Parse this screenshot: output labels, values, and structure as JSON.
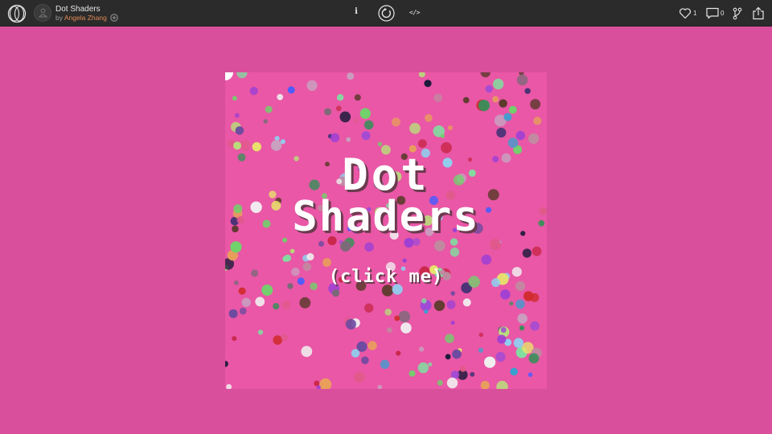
{
  "header": {
    "title": "Dot Shaders",
    "byline_prefix": "by",
    "author": "Angela Zhang",
    "info_label": "i",
    "code_label": "</>",
    "likes": "1",
    "comments": "0"
  },
  "stage": {
    "headline_line1": "Dot",
    "headline_line2": "Shaders",
    "cta": "(click me)"
  },
  "colors": {
    "page_bg": "#d94f9b",
    "stage_bg": "#e957a6",
    "topbar_bg": "#2b2b2b",
    "author_accent": "#e08a54"
  }
}
